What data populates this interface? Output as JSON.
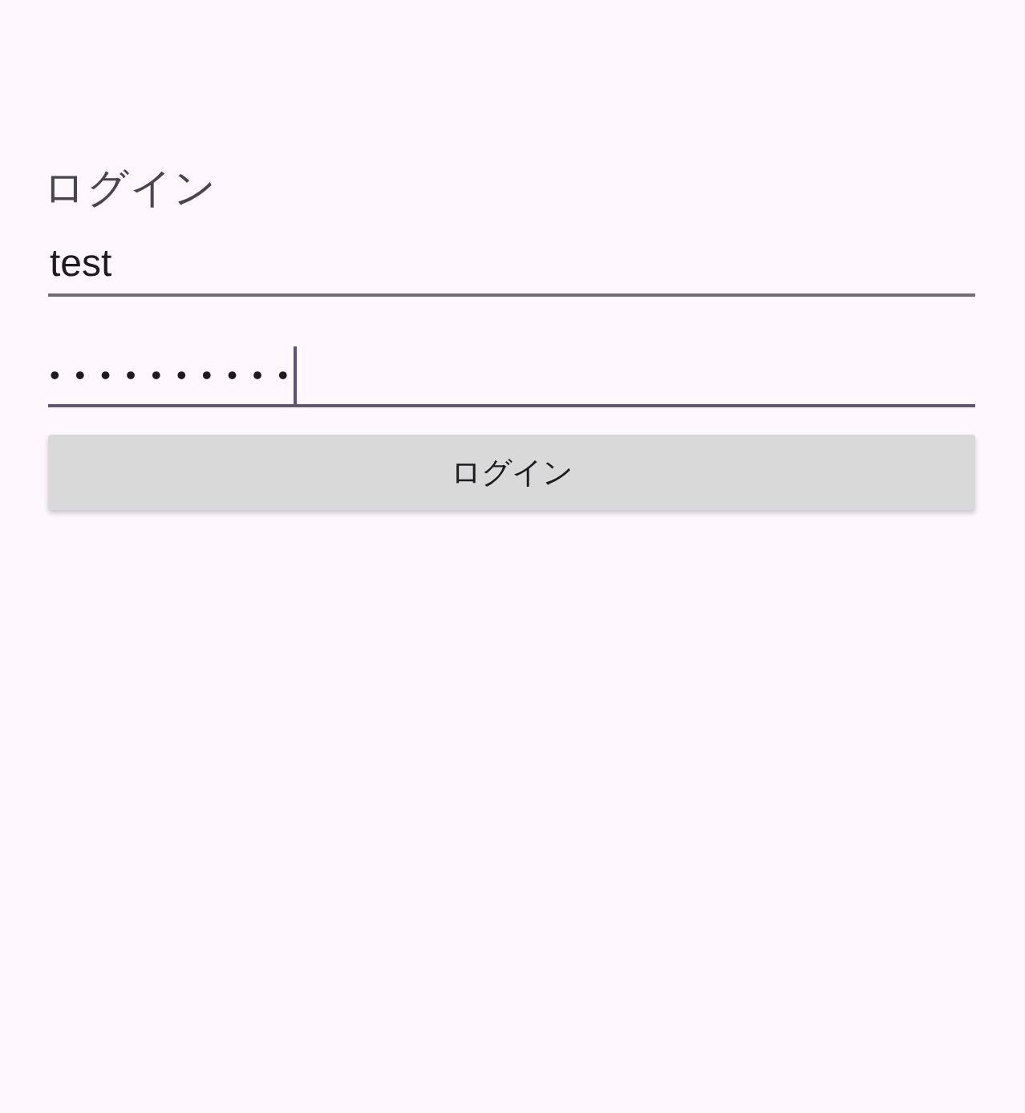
{
  "title": "ログイン",
  "fields": [
    {
      "kind": "text",
      "value": "test",
      "focused": false
    },
    {
      "kind": "password",
      "value": "••••••••••",
      "focused": true
    }
  ],
  "button": {
    "label": "ログイン"
  }
}
